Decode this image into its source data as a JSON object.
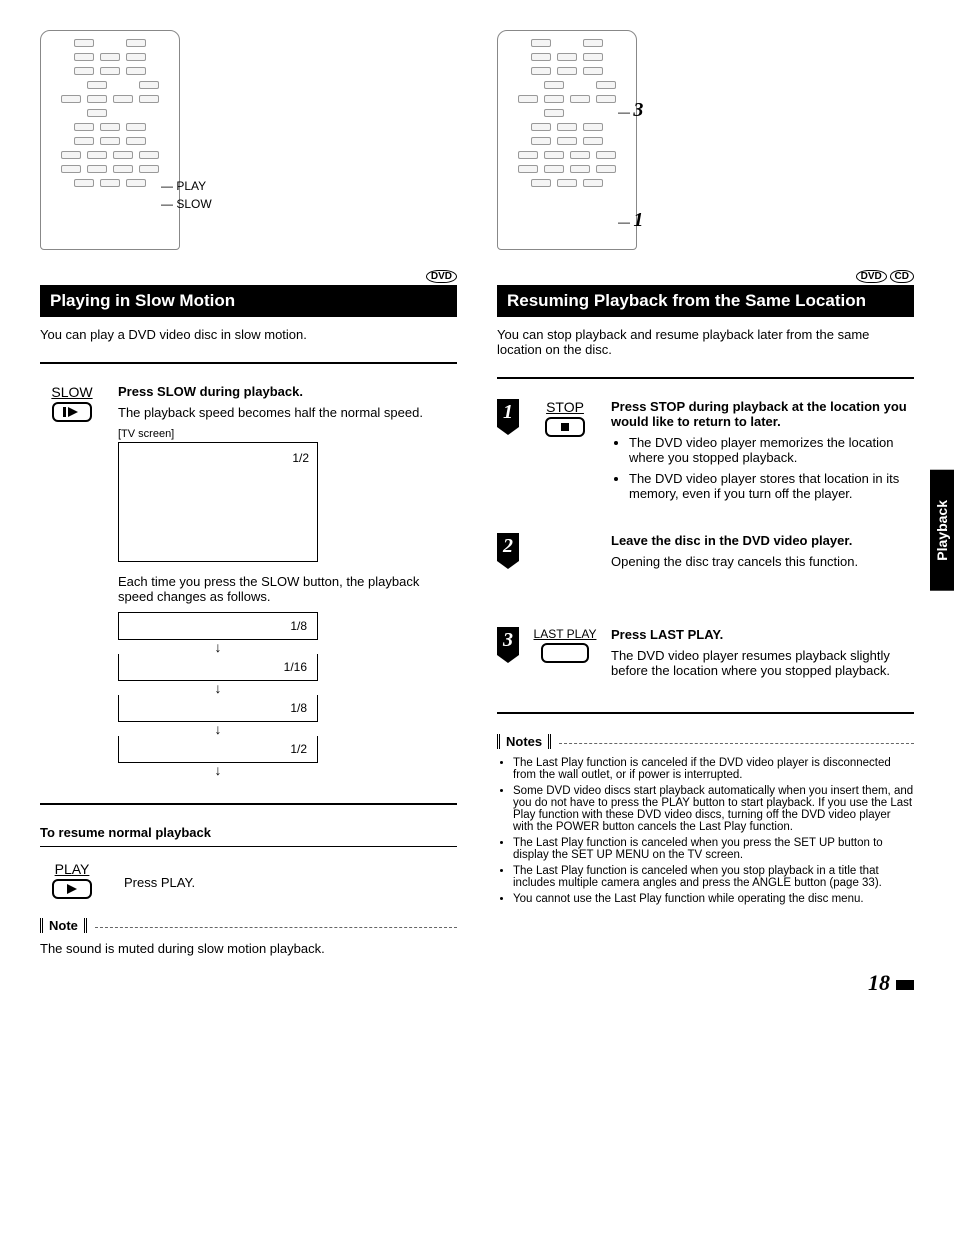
{
  "sideTab": "Playback",
  "pageNumber": "18",
  "left": {
    "remote": {
      "callouts": [
        "PLAY",
        "SLOW"
      ]
    },
    "discBadge": "DVD",
    "heading": "Playing in Slow Motion",
    "intro": "You can play a DVD video disc in slow motion.",
    "step": {
      "iconLabel": "SLOW",
      "title": "Press SLOW during playback.",
      "text1": "The playback speed becomes half the normal speed.",
      "tvLabel": "[TV screen]",
      "tvValue": "1/2",
      "text2": "Each time you press the SLOW button, the playback speed changes as follows.",
      "speeds": [
        "1/8",
        "1/16",
        "1/8",
        "1/2"
      ]
    },
    "resume": {
      "heading": "To resume normal playback",
      "iconLabel": "PLAY",
      "text": "Press PLAY."
    },
    "noteLabel": "Note",
    "noteText": "The sound is muted during slow motion playback."
  },
  "right": {
    "remote": {
      "callouts": [
        "3",
        "1"
      ]
    },
    "discBadges": [
      "DVD",
      "CD"
    ],
    "heading": "Resuming Playback from the Same Location",
    "intro": "You can stop playback and resume playback later from the same location on the disc.",
    "steps": [
      {
        "num": "1",
        "iconLabel": "STOP",
        "title": "Press STOP during playback at the location you would like to return to later.",
        "bullets": [
          "The DVD video player memorizes the location where you stopped playback.",
          "The DVD video player stores that location in its memory, even if you turn off the player."
        ]
      },
      {
        "num": "2",
        "title": "Leave the disc in the DVD video player.",
        "text": "Opening the disc tray cancels this function."
      },
      {
        "num": "3",
        "iconLabel": "LAST PLAY",
        "title": "Press LAST PLAY.",
        "text": "The DVD video player resumes playback slightly before the location where you stopped playback."
      }
    ],
    "notesLabel": "Notes",
    "notes": [
      "The Last Play function is canceled if the DVD video player is disconnected from the wall outlet, or if power is interrupted.",
      "Some DVD video discs start playback automatically when you insert them, and you do not have to press the PLAY button to start playback. If you use the Last Play function with these DVD video discs, turning off the DVD video player with the POWER button cancels the Last Play function.",
      "The Last Play function is canceled when you press the SET UP button to display the SET UP MENU on the TV screen.",
      "The Last Play function is canceled when you stop playback in a title that includes multiple camera angles and press the ANGLE button (page 33).",
      "You cannot use the Last Play function while operating the disc menu."
    ]
  }
}
